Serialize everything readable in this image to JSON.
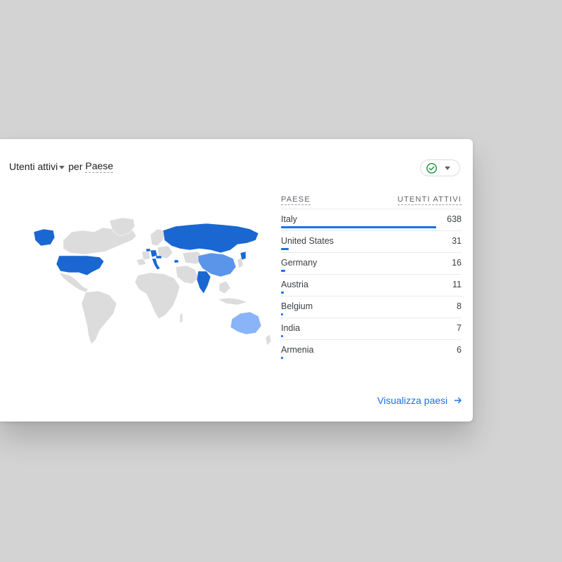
{
  "card": {
    "title": {
      "metric": "Utenti attivi",
      "per": "per",
      "dimension": "Paese"
    },
    "status_icon": "check-circle-icon",
    "status_color": "#1e8e3e",
    "map": {
      "colors": {
        "high": "#1a67d2",
        "medium": "#5a95ea",
        "low": "#8ab4f8",
        "none": "#dcdcdc"
      }
    },
    "table": {
      "headers": {
        "country": "PAESE",
        "users": "UTENTI ATTIVI"
      },
      "rows": [
        {
          "country": "Italy",
          "value": "638",
          "share": 1.0
        },
        {
          "country": "United States",
          "value": "31",
          "share": 0.049
        },
        {
          "country": "Germany",
          "value": "16",
          "share": 0.025
        },
        {
          "country": "Austria",
          "value": "11",
          "share": 0.017
        },
        {
          "country": "Belgium",
          "value": "8",
          "share": 0.013
        },
        {
          "country": "India",
          "value": "7",
          "share": 0.011
        },
        {
          "country": "Armenia",
          "value": "6",
          "share": 0.009
        }
      ]
    },
    "view_link": {
      "label": "Visualizza paesi",
      "icon": "arrow-right-icon"
    }
  }
}
